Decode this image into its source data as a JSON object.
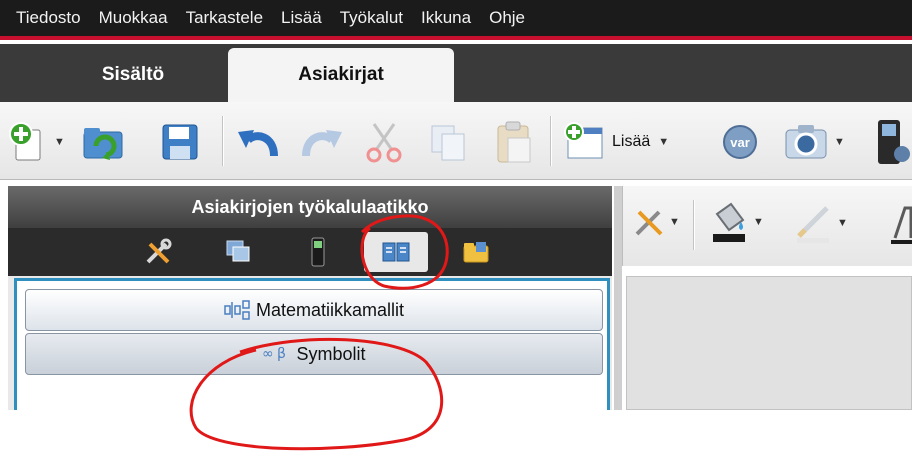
{
  "menubar": {
    "items": [
      "Tiedosto",
      "Muokkaa",
      "Tarkastele",
      "Lisää",
      "Työkalut",
      "Ikkuna",
      "Ohje"
    ]
  },
  "tabs": {
    "content": "Sisältö",
    "documents": "Asiakirjat"
  },
  "toolbar": {
    "insert_label": "Lisää",
    "var_label": "var"
  },
  "left_panel": {
    "title": "Asiakirjojen työkalulaatikko",
    "math_templates": "Matematiikkamallit",
    "symbols": "Symbolit"
  },
  "colors": {
    "menubar_bg": "#1b1b1b",
    "accent_red": "#c8102e",
    "panel_border": "#2f8fbf",
    "annotation": "#e01818"
  }
}
